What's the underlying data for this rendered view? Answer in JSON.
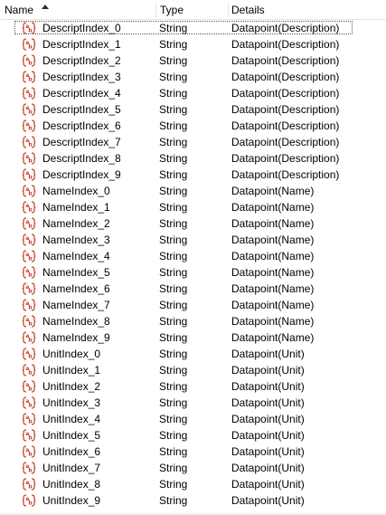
{
  "columns": {
    "name": "Name",
    "type": "Type",
    "details": "Details"
  },
  "row_icon": "string-variable-icon",
  "colors": {
    "icon": "#c83a2a",
    "focus_border": "#555555"
  },
  "rows": [
    {
      "name": "DescriptIndex_0",
      "type": "String",
      "details": "Datapoint(Description)"
    },
    {
      "name": "DescriptIndex_1",
      "type": "String",
      "details": "Datapoint(Description)"
    },
    {
      "name": "DescriptIndex_2",
      "type": "String",
      "details": "Datapoint(Description)"
    },
    {
      "name": "DescriptIndex_3",
      "type": "String",
      "details": "Datapoint(Description)"
    },
    {
      "name": "DescriptIndex_4",
      "type": "String",
      "details": "Datapoint(Description)"
    },
    {
      "name": "DescriptIndex_5",
      "type": "String",
      "details": "Datapoint(Description)"
    },
    {
      "name": "DescriptIndex_6",
      "type": "String",
      "details": "Datapoint(Description)"
    },
    {
      "name": "DescriptIndex_7",
      "type": "String",
      "details": "Datapoint(Description)"
    },
    {
      "name": "DescriptIndex_8",
      "type": "String",
      "details": "Datapoint(Description)"
    },
    {
      "name": "DescriptIndex_9",
      "type": "String",
      "details": "Datapoint(Description)"
    },
    {
      "name": "NameIndex_0",
      "type": "String",
      "details": "Datapoint(Name)"
    },
    {
      "name": "NameIndex_1",
      "type": "String",
      "details": "Datapoint(Name)"
    },
    {
      "name": "NameIndex_2",
      "type": "String",
      "details": "Datapoint(Name)"
    },
    {
      "name": "NameIndex_3",
      "type": "String",
      "details": "Datapoint(Name)"
    },
    {
      "name": "NameIndex_4",
      "type": "String",
      "details": "Datapoint(Name)"
    },
    {
      "name": "NameIndex_5",
      "type": "String",
      "details": "Datapoint(Name)"
    },
    {
      "name": "NameIndex_6",
      "type": "String",
      "details": "Datapoint(Name)"
    },
    {
      "name": "NameIndex_7",
      "type": "String",
      "details": "Datapoint(Name)"
    },
    {
      "name": "NameIndex_8",
      "type": "String",
      "details": "Datapoint(Name)"
    },
    {
      "name": "NameIndex_9",
      "type": "String",
      "details": "Datapoint(Name)"
    },
    {
      "name": "UnitIndex_0",
      "type": "String",
      "details": "Datapoint(Unit)"
    },
    {
      "name": "UnitIndex_1",
      "type": "String",
      "details": "Datapoint(Unit)"
    },
    {
      "name": "UnitIndex_2",
      "type": "String",
      "details": "Datapoint(Unit)"
    },
    {
      "name": "UnitIndex_3",
      "type": "String",
      "details": "Datapoint(Unit)"
    },
    {
      "name": "UnitIndex_4",
      "type": "String",
      "details": "Datapoint(Unit)"
    },
    {
      "name": "UnitIndex_5",
      "type": "String",
      "details": "Datapoint(Unit)"
    },
    {
      "name": "UnitIndex_6",
      "type": "String",
      "details": "Datapoint(Unit)"
    },
    {
      "name": "UnitIndex_7",
      "type": "String",
      "details": "Datapoint(Unit)"
    },
    {
      "name": "UnitIndex_8",
      "type": "String",
      "details": "Datapoint(Unit)"
    },
    {
      "name": "UnitIndex_9",
      "type": "String",
      "details": "Datapoint(Unit)"
    }
  ]
}
